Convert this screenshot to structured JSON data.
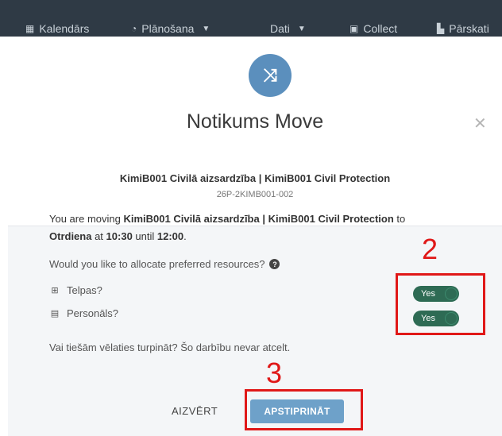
{
  "nav": {
    "items": [
      {
        "icon": "calendar-icon",
        "glyph": "▦",
        "label": "Kalendārs",
        "chevron": false
      },
      {
        "icon": "clock-icon",
        "glyph": "◔",
        "label": "Plānošana",
        "chevron": true
      },
      {
        "icon": "data-icon",
        "glyph": "",
        "label": "Dati",
        "chevron": true
      },
      {
        "icon": "collect-icon",
        "glyph": "▣",
        "label": "Collect",
        "chevron": false
      },
      {
        "icon": "report-icon",
        "glyph": "▙",
        "label": "Pārskati",
        "chevron": false
      }
    ]
  },
  "modal": {
    "icon_glyph": "⤨",
    "title": "Notikums Move",
    "close_glyph": "✕",
    "event_name": "KimiB001 Civilā aizsardzība | KimiB001 Civil Protection",
    "event_code": "26P-2KIMB001-002",
    "description": {
      "prefix": "You are moving ",
      "event": "KimiB001 Civilā aizsardzība | KimiB001 Civil Protection",
      "to": " to ",
      "day": "Otrdiena",
      "at": " at ",
      "start": "10:30",
      "until": " until ",
      "end": "12:00",
      "suffix": "."
    },
    "question": "Would you like to allocate preferred resources?",
    "help_glyph": "?",
    "resources": [
      {
        "icon_glyph": "⊞",
        "label": "Telpas?",
        "toggle": "Yes"
      },
      {
        "icon_glyph": "▤",
        "label": "Personāls?",
        "toggle": "Yes"
      }
    ],
    "confirm_text": "Vai tiešām vēlaties turpināt? Šo darbību nevar atcelt.",
    "close_button": "AIZVĒRT",
    "confirm_button": "APSTIPRINĀT"
  },
  "annotations": {
    "label_2": "2",
    "label_3": "3",
    "color": "#e01818"
  },
  "colors": {
    "nav_bg": "#2f3a45",
    "accent": "#5b8fbd",
    "toggle_on": "#2e6b54",
    "confirm_button": "#6ea1c9"
  }
}
